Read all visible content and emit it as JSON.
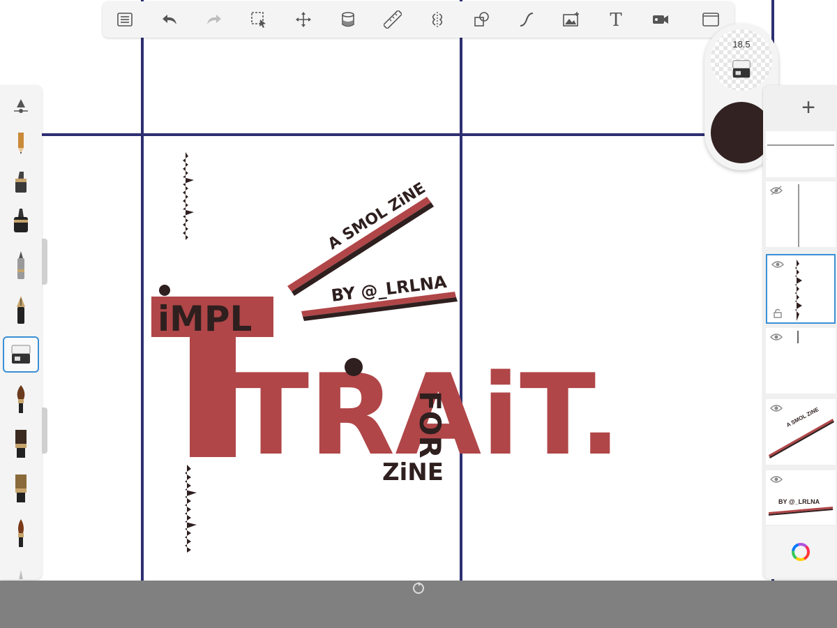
{
  "app": {
    "toolbar": {
      "items": [
        {
          "name": "layers-list-icon",
          "label": "Menu"
        },
        {
          "name": "undo-icon",
          "label": "Undo"
        },
        {
          "name": "redo-icon",
          "label": "Redo"
        },
        {
          "name": "selection-icon",
          "label": "Selection"
        },
        {
          "name": "transform-icon",
          "label": "Transform"
        },
        {
          "name": "fill-bucket-icon",
          "label": "Fill"
        },
        {
          "name": "ruler-icon",
          "label": "Guides"
        },
        {
          "name": "symmetry-icon",
          "label": "Symmetry"
        },
        {
          "name": "shapes-icon",
          "label": "Shapes"
        },
        {
          "name": "curve-icon",
          "label": "Curves"
        },
        {
          "name": "import-image-icon",
          "label": "Import image"
        },
        {
          "name": "text-icon",
          "label": "Text"
        },
        {
          "name": "video-icon",
          "label": "Time-lapse"
        },
        {
          "name": "fullscreen-icon",
          "label": "Fullscreen"
        }
      ]
    },
    "brush_puck": {
      "size_value": "18.5",
      "current_color": "#332222"
    },
    "colors": {
      "accent": "#3a8fd6",
      "grid": "#2e2f72",
      "art_red": "#b04648",
      "art_dark": "#2f1f1f"
    }
  },
  "artwork": {
    "title_word_1": "iMPL",
    "title_word_2": "TRAiT.",
    "for_text": "FOR",
    "zine_text": "ZiNE",
    "tagline": "A SMOL ZiNE",
    "byline": "BY @_LRLNA"
  },
  "layers": [
    {
      "name": "layer-1",
      "visible": true
    },
    {
      "name": "layer-2",
      "visible": false
    },
    {
      "name": "layer-3",
      "visible": true,
      "selected": true
    },
    {
      "name": "layer-4",
      "visible": true
    },
    {
      "name": "layer-5",
      "visible": true,
      "preview": "A SMOL ZiNE"
    },
    {
      "name": "layer-6",
      "visible": true,
      "preview": "BY @_LRLNA"
    }
  ]
}
